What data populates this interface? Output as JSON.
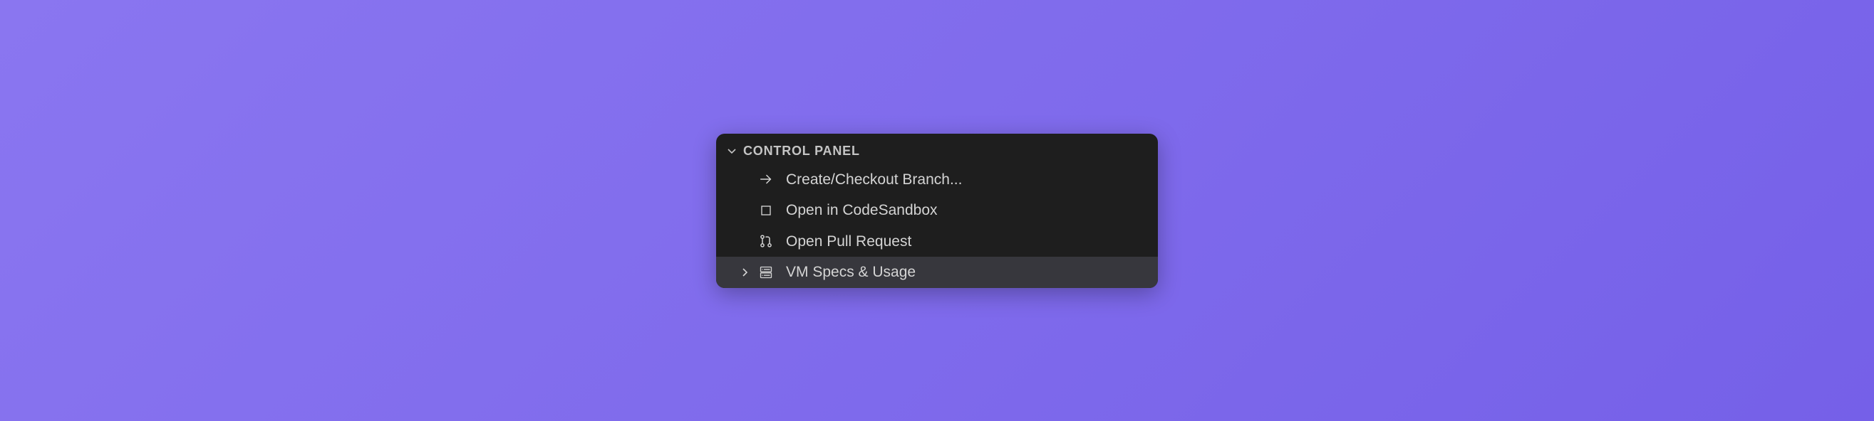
{
  "panel": {
    "title": "CONTROL PANEL",
    "items": [
      {
        "label": "Create/Checkout Branch...",
        "icon": "arrow-right",
        "expandable": false,
        "highlighted": false
      },
      {
        "label": "Open in CodeSandbox",
        "icon": "square",
        "expandable": false,
        "highlighted": false
      },
      {
        "label": "Open Pull Request",
        "icon": "git-pull-request",
        "expandable": false,
        "highlighted": false
      },
      {
        "label": "VM Specs & Usage",
        "icon": "server",
        "expandable": true,
        "highlighted": true
      }
    ]
  }
}
